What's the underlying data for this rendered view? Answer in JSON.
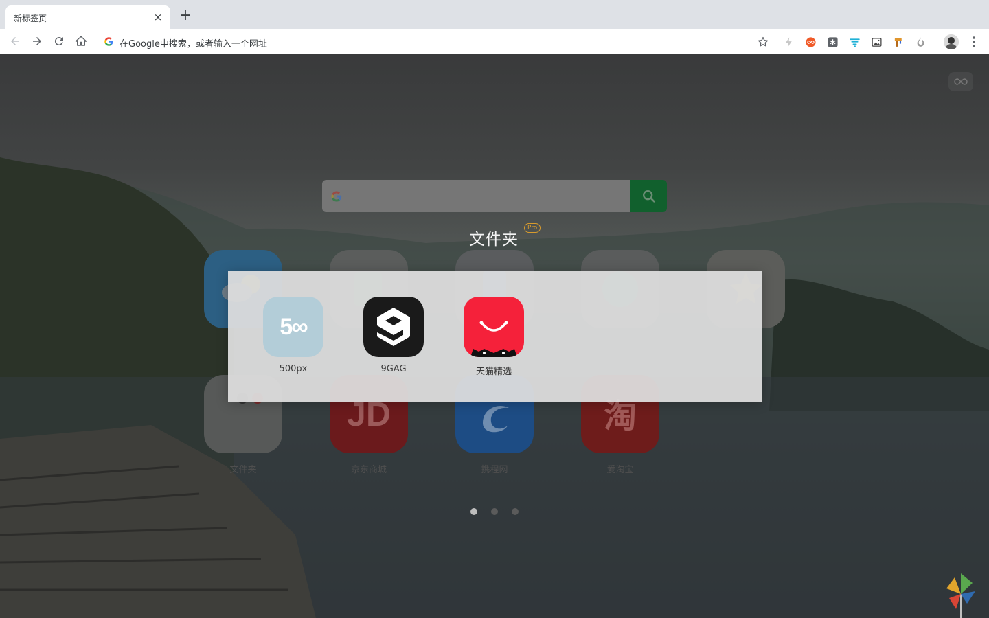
{
  "browser": {
    "tab_title": "新标签页",
    "tab_close": "×",
    "new_tab": "+",
    "omnibox_placeholder": "在Google中搜索，或者输入一个网址"
  },
  "page": {
    "folder_title": "文件夹",
    "pro_badge": "Pro",
    "background_sites": [
      {
        "label": "文件夹",
        "icon": "folder-icon"
      },
      {
        "label": "京东商城",
        "icon": "jd-logo-icon"
      },
      {
        "label": "携程网",
        "icon": "ctrip-dolphin-icon"
      },
      {
        "label": "爱淘宝",
        "icon": "taobao-icon"
      }
    ],
    "background_sites_top": [
      {
        "label": "",
        "icon": "weather-icon"
      },
      {
        "label": "",
        "icon": "notes-icon"
      },
      {
        "label": "",
        "icon": "phone-icon"
      },
      {
        "label": "",
        "icon": "clock-icon"
      },
      {
        "label": "",
        "icon": "star-icon"
      }
    ],
    "folder_apps": [
      {
        "label": "500px",
        "icon": "500px-logo-icon",
        "color": "#b3cdd8"
      },
      {
        "label": "9GAG",
        "icon": "9gag-logo-icon",
        "color": "#1a1a1a"
      },
      {
        "label": "天猫精选",
        "icon": "tmall-cat-icon",
        "color": "#f5213a"
      }
    ],
    "pagination": {
      "pages": 3,
      "current": 1
    }
  },
  "colors": {
    "search_button": "#11602d",
    "pro_badge": "#d89b2d",
    "tmall_red": "#f5213a"
  }
}
